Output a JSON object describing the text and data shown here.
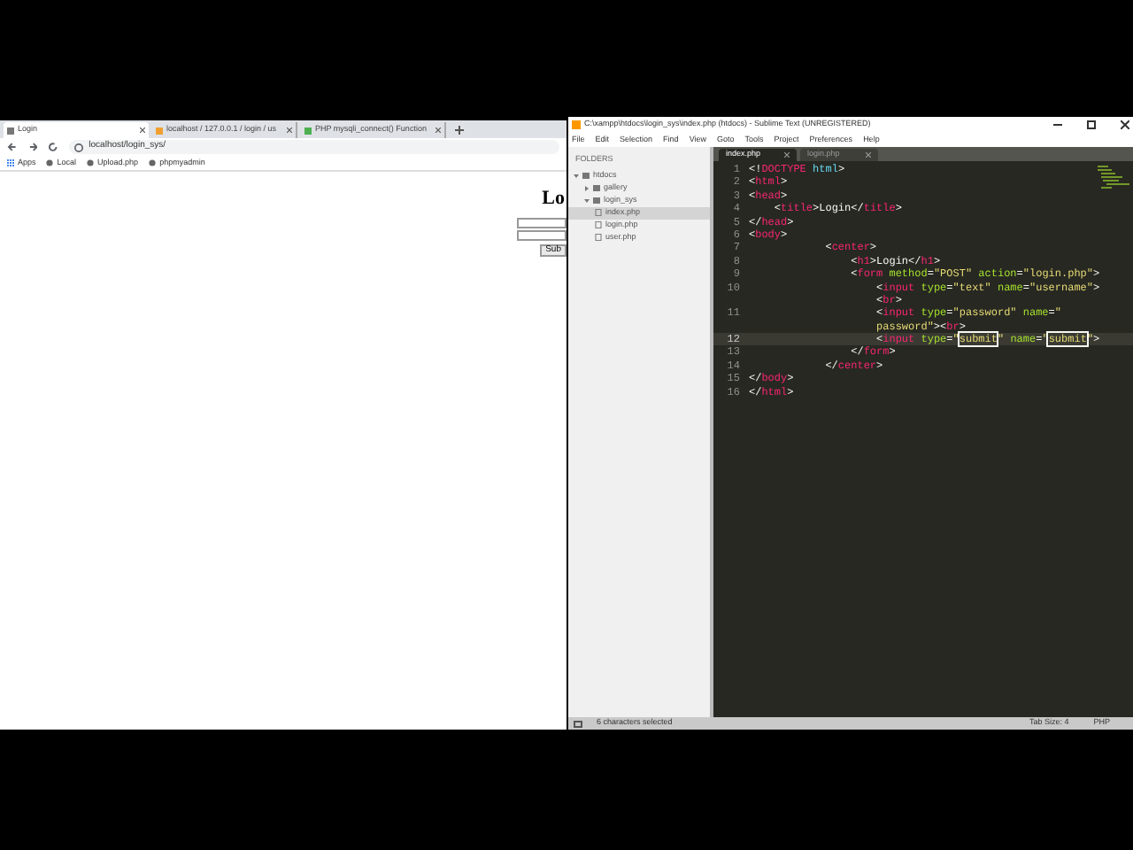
{
  "browser": {
    "tabs": [
      {
        "label": "Login",
        "selected": true
      },
      {
        "label": "localhost / 127.0.0.1 / login / us",
        "selected": false
      },
      {
        "label": "PHP mysqli_connect() Function",
        "selected": false
      }
    ],
    "address": "localhost/login_sys/",
    "bookmarks": [
      "Apps",
      "Local",
      "Upload.php",
      "phpmyadmin"
    ],
    "page": {
      "heading": "Lo",
      "button": "Sub"
    }
  },
  "editor": {
    "title": "C:\\xampp\\htdocs\\login_sys\\index.php (htdocs) - Sublime Text (UNREGISTERED)",
    "menu": [
      "File",
      "Edit",
      "Selection",
      "Find",
      "View",
      "Goto",
      "Tools",
      "Project",
      "Preferences",
      "Help"
    ],
    "sidebar": {
      "heading": "FOLDERS",
      "tree": [
        {
          "kind": "folder",
          "label": "htdocs",
          "expanded": true,
          "children": [
            {
              "kind": "folder",
              "label": "gallery",
              "expanded": false
            },
            {
              "kind": "folder",
              "label": "login_sys",
              "expanded": true,
              "children": [
                {
                  "kind": "file",
                  "label": "index.php",
                  "selected": true
                },
                {
                  "kind": "file",
                  "label": "login.php",
                  "selected": false
                },
                {
                  "kind": "file",
                  "label": "user.php",
                  "selected": false
                }
              ]
            }
          ]
        }
      ]
    },
    "tabs": [
      {
        "label": "index.php",
        "selected": true
      },
      {
        "label": "login.php",
        "selected": false
      }
    ],
    "lines": [
      {
        "number": "1",
        "current": false,
        "segments": [
          [
            {
              "kind": "p",
              "text": "<!"
            },
            {
              "kind": "t",
              "text": "DOCTYPE"
            },
            {
              "kind": "k",
              "text": " html"
            },
            {
              "kind": "p",
              "text": ">"
            }
          ]
        ]
      },
      {
        "number": "2",
        "current": false,
        "segments": [
          [
            {
              "kind": "p",
              "text": "<"
            },
            {
              "kind": "t",
              "text": "html"
            },
            {
              "kind": "p",
              "text": ">"
            }
          ]
        ]
      },
      {
        "number": "3",
        "current": false,
        "segments": [
          [
            {
              "kind": "p",
              "text": "<"
            },
            {
              "kind": "t",
              "text": "head"
            },
            {
              "kind": "p",
              "text": ">"
            }
          ]
        ]
      },
      {
        "number": "4",
        "current": false,
        "segments": [
          [
            {
              "kind": "p",
              "text": "    <"
            },
            {
              "kind": "t",
              "text": "title"
            },
            {
              "kind": "p",
              "text": ">Login</"
            },
            {
              "kind": "t",
              "text": "title"
            },
            {
              "kind": "p",
              "text": ">"
            }
          ]
        ]
      },
      {
        "number": "5",
        "current": false,
        "segments": [
          [
            {
              "kind": "p",
              "text": "</"
            },
            {
              "kind": "t",
              "text": "head"
            },
            {
              "kind": "p",
              "text": ">"
            }
          ]
        ]
      },
      {
        "number": "6",
        "current": false,
        "segments": [
          [
            {
              "kind": "p",
              "text": "<"
            },
            {
              "kind": "t",
              "text": "body"
            },
            {
              "kind": "p",
              "text": ">"
            }
          ]
        ]
      },
      {
        "number": "7",
        "current": false,
        "segments": [
          [
            {
              "kind": "p",
              "text": "            <"
            },
            {
              "kind": "t",
              "text": "center"
            },
            {
              "kind": "p",
              "text": ">"
            }
          ]
        ]
      },
      {
        "number": "8",
        "current": false,
        "segments": [
          [
            {
              "kind": "p",
              "text": "                <"
            },
            {
              "kind": "t",
              "text": "h1"
            },
            {
              "kind": "p",
              "text": ">Login</"
            },
            {
              "kind": "t",
              "text": "h1"
            },
            {
              "kind": "p",
              "text": ">"
            }
          ]
        ]
      },
      {
        "number": "9",
        "current": false,
        "segments": [
          [
            {
              "kind": "p",
              "text": "                <"
            },
            {
              "kind": "t",
              "text": "form"
            },
            {
              "kind": "a",
              "text": " method"
            },
            {
              "kind": "p",
              "text": "="
            },
            {
              "kind": "s",
              "text": "\"POST\""
            },
            {
              "kind": "a",
              "text": " action"
            },
            {
              "kind": "p",
              "text": "="
            },
            {
              "kind": "s",
              "text": "\"login.php\""
            },
            {
              "kind": "p",
              "text": ">"
            }
          ]
        ]
      },
      {
        "number": "10",
        "current": false,
        "segments": [
          [
            {
              "kind": "p",
              "text": "                    <"
            },
            {
              "kind": "t",
              "text": "input"
            },
            {
              "kind": "a",
              "text": " type"
            },
            {
              "kind": "p",
              "text": "="
            },
            {
              "kind": "s",
              "text": "\"text\""
            },
            {
              "kind": "a",
              "text": " name"
            },
            {
              "kind": "p",
              "text": "="
            },
            {
              "kind": "s",
              "text": "\"username\""
            },
            {
              "kind": "p",
              "text": ">"
            }
          ],
          [
            {
              "kind": "p",
              "text": "                    <"
            },
            {
              "kind": "t",
              "text": "br"
            },
            {
              "kind": "p",
              "text": ">"
            }
          ]
        ]
      },
      {
        "number": "11",
        "current": false,
        "segments": [
          [
            {
              "kind": "p",
              "text": "                    <"
            },
            {
              "kind": "t",
              "text": "input"
            },
            {
              "kind": "a",
              "text": " type"
            },
            {
              "kind": "p",
              "text": "="
            },
            {
              "kind": "s",
              "text": "\"password\""
            },
            {
              "kind": "a",
              "text": " name"
            },
            {
              "kind": "p",
              "text": "="
            },
            {
              "kind": "s",
              "text": "\""
            }
          ],
          [
            {
              "kind": "s",
              "text": "                    password\""
            },
            {
              "kind": "p",
              "text": "><"
            },
            {
              "kind": "t",
              "text": "br"
            },
            {
              "kind": "p",
              "text": ">"
            }
          ]
        ]
      },
      {
        "number": "12",
        "current": true,
        "segments": [
          [
            {
              "kind": "p",
              "text": "                    <"
            },
            {
              "kind": "t",
              "text": "input"
            },
            {
              "kind": "a",
              "text": " type"
            },
            {
              "kind": "p",
              "text": "="
            },
            {
              "kind": "s",
              "text": "\""
            },
            {
              "kind": "m",
              "text": "submit"
            },
            {
              "kind": "s",
              "text": "\""
            },
            {
              "kind": "a",
              "text": " name"
            },
            {
              "kind": "p",
              "text": "="
            },
            {
              "kind": "s",
              "text": "\""
            },
            {
              "kind": "m",
              "text": "submit"
            },
            {
              "kind": "s",
              "text": "\""
            },
            {
              "kind": "p",
              "text": ">"
            }
          ]
        ]
      },
      {
        "number": "13",
        "current": false,
        "segments": [
          [
            {
              "kind": "p",
              "text": "                </"
            },
            {
              "kind": "t",
              "text": "form"
            },
            {
              "kind": "p",
              "text": ">"
            }
          ]
        ]
      },
      {
        "number": "14",
        "current": false,
        "segments": [
          [
            {
              "kind": "p",
              "text": "            </"
            },
            {
              "kind": "t",
              "text": "center"
            },
            {
              "kind": "p",
              "text": ">"
            }
          ]
        ]
      },
      {
        "number": "15",
        "current": false,
        "segments": [
          [
            {
              "kind": "p",
              "text": "</"
            },
            {
              "kind": "t",
              "text": "body"
            },
            {
              "kind": "p",
              "text": ">"
            }
          ]
        ]
      },
      {
        "number": "16",
        "current": false,
        "segments": [
          [
            {
              "kind": "p",
              "text": "</"
            },
            {
              "kind": "t",
              "text": "html"
            },
            {
              "kind": "p",
              "text": ">"
            }
          ]
        ]
      }
    ],
    "status_bar": {
      "left": "6 characters selected",
      "right": [
        "Tab Size: 4",
        "PHP"
      ]
    }
  }
}
